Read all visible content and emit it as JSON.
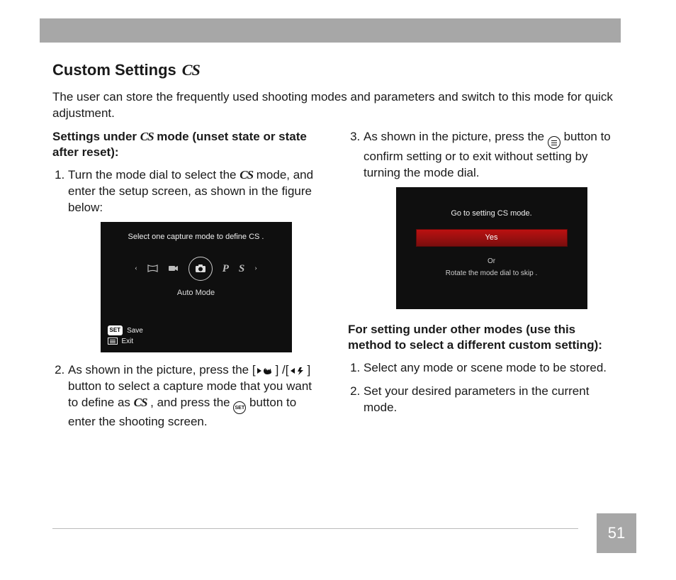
{
  "header": {
    "title": "Custom Settings",
    "title_icon": "CS"
  },
  "intro": "The user can store the frequently used shooting modes and parameters and switch to this mode for quick adjustment.",
  "left": {
    "subhead_pre": "Settings under ",
    "subhead_icon": "CS",
    "subhead_post": " mode (unset state or state after reset):",
    "step1_pre": "Turn the mode dial to select the ",
    "step1_icon": "CS",
    "step1_post": " mode, and enter the setup screen, as shown in the figure below:",
    "lcd1": {
      "prompt": "Select one capture mode to define CS .",
      "mode_labels": {
        "p": "P",
        "s": "S"
      },
      "auto": "Auto Mode",
      "save_badge": "SET",
      "save": "Save",
      "exit": "Exit"
    },
    "step2_a": "As shown in the picture, press the [",
    "step2_b": "] /[",
    "step2_c": "] button to select a capture mode that you want to define as ",
    "step2_cs": "CS",
    "step2_d": " , and press the ",
    "step2_set": "SET",
    "step2_e": " button to enter the shooting screen."
  },
  "right": {
    "step3_a": "As shown in the picture, press the ",
    "step3_b": " button to confirm setting or to exit without setting by turning the mode dial.",
    "lcd2": {
      "title": "Go to setting CS mode.",
      "yes": "Yes",
      "or": "Or",
      "skip": "Rotate the mode dial to skip ."
    },
    "subhead": "For setting under other modes (use this method to select a different custom setting):",
    "other1": "Select any mode or scene mode to be stored.",
    "other2": "Set your desired parameters in the current mode."
  },
  "page_number": "51"
}
